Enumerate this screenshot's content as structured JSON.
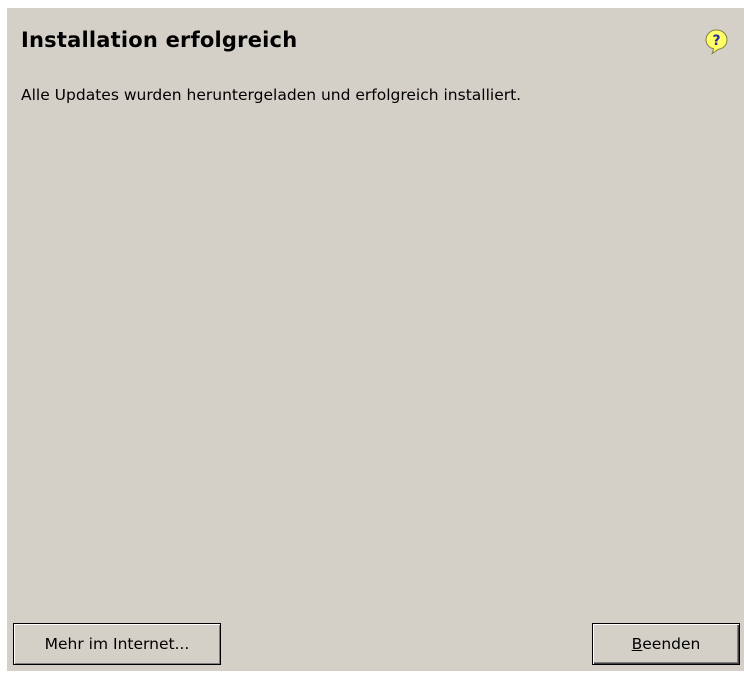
{
  "dialog": {
    "title": "Installation erfolgreich",
    "message": "Alle Updates wurden heruntergeladen und erfolgreich installiert.",
    "help_icon": "question-mark-icon",
    "buttons": {
      "more": {
        "label": "Mehr im Internet..."
      },
      "finish": {
        "mnemonic": "B",
        "label_rest": "eenden"
      }
    }
  },
  "colors": {
    "dialog_bg": "#d4d0c8",
    "help_icon_fill": "#ffff66",
    "help_icon_glyph": "#2a2a9a"
  }
}
